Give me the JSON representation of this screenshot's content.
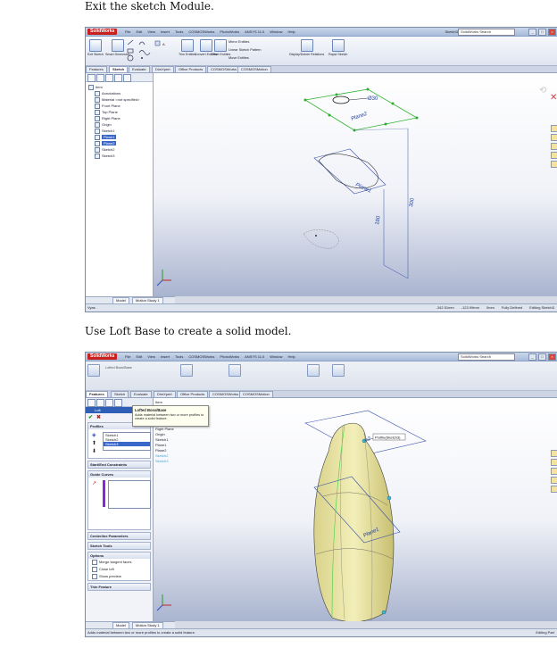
{
  "captions": {
    "step1": "Exit the sketch Module.",
    "step2": "Use Loft Base to create a solid model."
  },
  "app": {
    "logo": "SolidWorks",
    "menu": [
      "File",
      "Edit",
      "View",
      "Insert",
      "Tools",
      "COSMOSWorks",
      "PhotoWorks",
      "ANSYS 11.0",
      "Window",
      "Help"
    ],
    "search": "SolidWorks Search",
    "sketch_label": "Sketch3"
  },
  "ribbon1": {
    "exit_sketch": "Exit Sketch",
    "smart_dimension": "Smart Dimension",
    "trim": "Trim Entities",
    "convert": "Convert Entities",
    "offset": "Offset Entities",
    "mirror": "Mirror Entities",
    "linear_pattern": "Linear Sketch Pattern",
    "move": "Move Entities",
    "relations": "Display/Delete Relations",
    "rapid": "Rapid Sketch"
  },
  "tabs": [
    "Features",
    "Sketch",
    "Evaluate",
    "DimXpert",
    "Office Products",
    "COSMOSWorks",
    "COSMOSMotion"
  ],
  "tree1": {
    "root": "Item",
    "items": [
      "Annotations",
      "Material <not specified>",
      "Front Plane",
      "Top Plane",
      "Right Plane",
      "Origin",
      "Sketch1",
      "Plane1",
      "Plane2",
      "Sketch2",
      "Sketch3"
    ]
  },
  "dims": {
    "d1": "Ø30",
    "d2": "300",
    "d3": "180"
  },
  "plane_labels": [
    "Plane2",
    "Plane1"
  ],
  "bottom_tabs": [
    "Model",
    "Motion Study 1"
  ],
  "status1": {
    "left": "Vyas",
    "coords": "-342.51mm",
    "coords2": "-123.99mm",
    "z": "0mm",
    "state": "Fully Defined",
    "editing": "Editing Sketch3"
  },
  "ribbon2": {
    "loft": "Lofted Boss/Base"
  },
  "tooltip": {
    "title": "Lofted Boss/Base",
    "body": "Adds material between two or more profiles to create a solid feature."
  },
  "pm": {
    "title": "Loft",
    "profiles": "Profiles",
    "profile_items": [
      "Sketch1",
      "Sketch2",
      "Sketch3"
    ],
    "start_end": "Start/End Constraints",
    "guide_curves": "Guide Curves",
    "centerline": "Centerline Parameters",
    "sketch_tools": "Sketch Tools",
    "options": "Options",
    "merge": "Merge tangent faces",
    "close": "Close loft",
    "preview": "Show preview",
    "thin": "Thin Feature"
  },
  "tree2": {
    "items": [
      "Item",
      "Annotations",
      "Material <not specified>",
      "Front Plane",
      "Top Plane",
      "Right Plane",
      "Origin",
      "Sketch1",
      "Plane1",
      "Plane2",
      "Sketch2",
      "Sketch3"
    ]
  },
  "callout2": "Profile(Sketch3)",
  "status2": {
    "left": "Adds material between two or more profiles to create a solid feature.",
    "editing": "Editing Part"
  }
}
